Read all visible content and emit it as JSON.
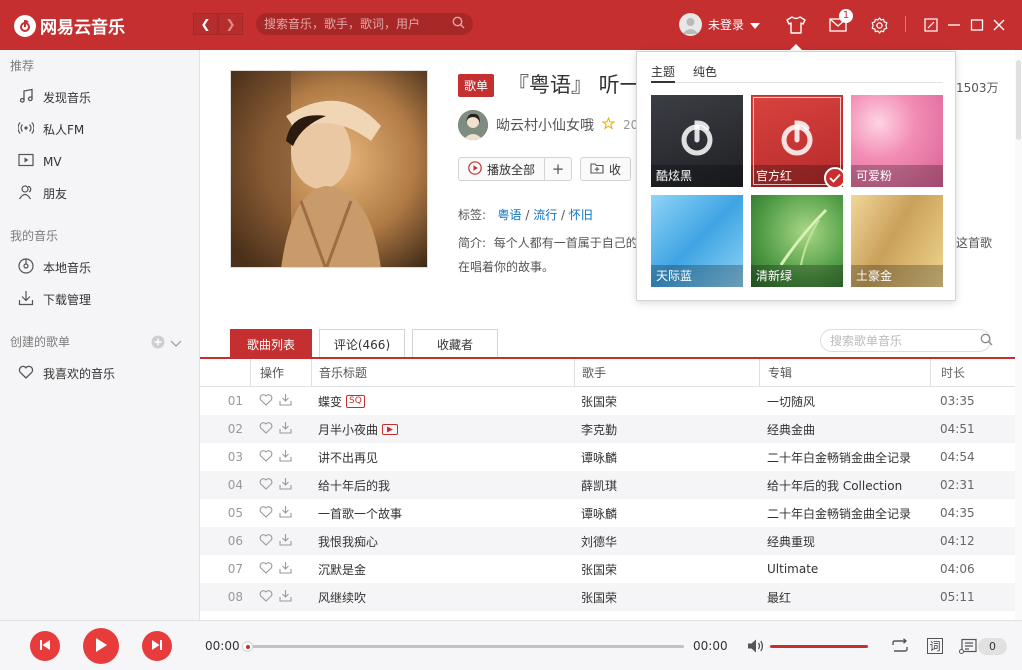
{
  "app": {
    "logo_text": "网易云音乐"
  },
  "titlebar": {
    "search_placeholder": "搜索音乐，歌手，歌词，用户",
    "user_name": "未登录",
    "mail_badge": "1"
  },
  "sidebar": {
    "sec_recommend": "推荐",
    "items_recommend": [
      {
        "label": "发现音乐",
        "icon": "music-note-icon"
      },
      {
        "label": "私人FM",
        "icon": "radio-icon"
      },
      {
        "label": "MV",
        "icon": "video-icon"
      },
      {
        "label": "朋友",
        "icon": "friends-icon"
      }
    ],
    "sec_mymusic": "我的音乐",
    "items_mymusic": [
      {
        "label": "本地音乐",
        "icon": "disc-icon"
      },
      {
        "label": "下载管理",
        "icon": "download-icon"
      }
    ],
    "sec_created": "创建的歌单",
    "items_created": [
      {
        "label": "我喜欢的音乐",
        "icon": "heart-icon"
      }
    ]
  },
  "playlist": {
    "type_badge": "歌单",
    "title": "『粤语』 听一",
    "play_count": "1503万",
    "creator_name": "呦云村小仙女哦",
    "create_date": "20",
    "play_all": "播放全部",
    "collect": "收",
    "tags_label": "标签:",
    "tags": [
      "粤语",
      "流行",
      "怀旧"
    ],
    "intro_label": "简介:",
    "intro_line1": "每个人都有一首属于自己的",
    "intro_line1_end": "这首歌",
    "intro_line2": "在唱着你的故事。"
  },
  "tabs": [
    {
      "label": "歌曲列表",
      "active": true
    },
    {
      "label": "评论(466)",
      "active": false
    },
    {
      "label": "收藏者",
      "active": false
    }
  ],
  "list_search_placeholder": "搜索歌单音乐",
  "table": {
    "headers": {
      "op": "操作",
      "title": "音乐标题",
      "artist": "歌手",
      "album": "专辑",
      "duration": "时长"
    },
    "rows": [
      {
        "idx": "01",
        "title": "蝶变",
        "mark": "SQ",
        "artist": "张国荣",
        "album": "一切随风",
        "duration": "03:35"
      },
      {
        "idx": "02",
        "title": "月半小夜曲",
        "mark": "MV",
        "artist": "李克勤",
        "album": "经典金曲",
        "duration": "04:51"
      },
      {
        "idx": "03",
        "title": "讲不出再见",
        "mark": "",
        "artist": "谭咏麟",
        "album": "二十年白金畅销金曲全记录",
        "duration": "04:54"
      },
      {
        "idx": "04",
        "title": "给十年后的我",
        "mark": "",
        "artist": "薛凯琪",
        "album": "给十年后的我 Collection",
        "duration": "02:31"
      },
      {
        "idx": "05",
        "title": "一首歌一个故事",
        "mark": "",
        "artist": "谭咏麟",
        "album": "二十年白金畅销金曲全记录",
        "duration": "04:35"
      },
      {
        "idx": "06",
        "title": "我恨我痴心",
        "mark": "",
        "artist": "刘德华",
        "album": "经典重现",
        "duration": "04:12"
      },
      {
        "idx": "07",
        "title": "沉默是金",
        "mark": "",
        "artist": "张国荣",
        "album": "Ultimate",
        "duration": "04:06"
      },
      {
        "idx": "08",
        "title": "风继续吹",
        "mark": "",
        "artist": "张国荣",
        "album": "最红",
        "duration": "05:11"
      }
    ]
  },
  "player": {
    "time_current": "00:00",
    "time_total": "00:00",
    "progress": 0,
    "volume": 1.0,
    "lyric_btn": "词",
    "playlist_count": "0"
  },
  "skin_panel": {
    "tabs": [
      {
        "label": "主题",
        "active": true
      },
      {
        "label": "纯色",
        "active": false
      }
    ],
    "skins": [
      {
        "label": "酷炫黑",
        "bg": "#2b2d31",
        "selected": false,
        "logo": true
      },
      {
        "label": "官方红",
        "bg": "#c62f2f",
        "selected": true,
        "logo": true
      },
      {
        "label": "可爱粉",
        "bg": "#f08fb4",
        "selected": false,
        "logo": false
      },
      {
        "label": "天际蓝",
        "bg": "#5ab4ea",
        "selected": false,
        "logo": false
      },
      {
        "label": "清新绿",
        "bg": "#56a24c",
        "selected": false,
        "logo": false
      },
      {
        "label": "土豪金",
        "bg": "#d9b26a",
        "selected": false,
        "logo": false
      }
    ]
  },
  "colors": {
    "accent": "#c62f2f",
    "link": "#0c73c2"
  }
}
